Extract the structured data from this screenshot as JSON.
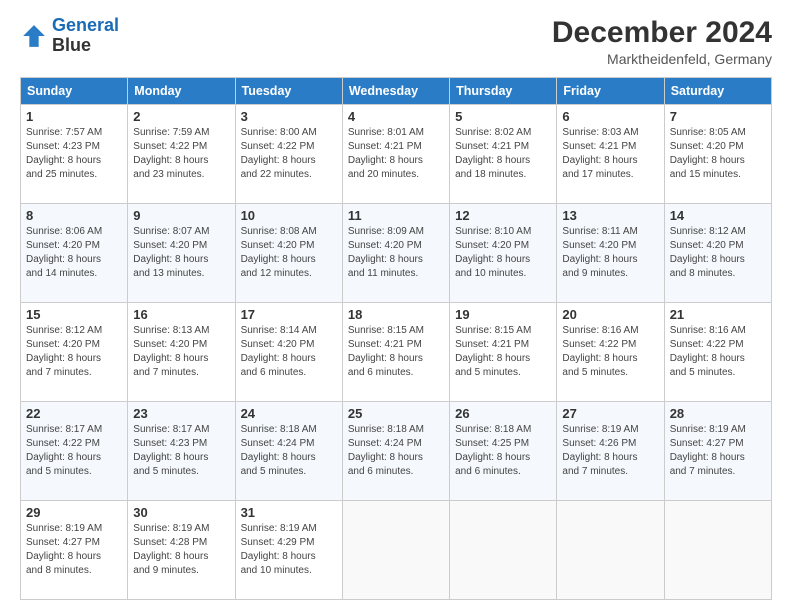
{
  "header": {
    "logo_line1": "General",
    "logo_line2": "Blue",
    "title": "December 2024",
    "subtitle": "Marktheidenfeld, Germany"
  },
  "weekdays": [
    "Sunday",
    "Monday",
    "Tuesday",
    "Wednesday",
    "Thursday",
    "Friday",
    "Saturday"
  ],
  "weeks": [
    [
      {
        "day": "1",
        "info": "Sunrise: 7:57 AM\nSunset: 4:23 PM\nDaylight: 8 hours\nand 25 minutes."
      },
      {
        "day": "2",
        "info": "Sunrise: 7:59 AM\nSunset: 4:22 PM\nDaylight: 8 hours\nand 23 minutes."
      },
      {
        "day": "3",
        "info": "Sunrise: 8:00 AM\nSunset: 4:22 PM\nDaylight: 8 hours\nand 22 minutes."
      },
      {
        "day": "4",
        "info": "Sunrise: 8:01 AM\nSunset: 4:21 PM\nDaylight: 8 hours\nand 20 minutes."
      },
      {
        "day": "5",
        "info": "Sunrise: 8:02 AM\nSunset: 4:21 PM\nDaylight: 8 hours\nand 18 minutes."
      },
      {
        "day": "6",
        "info": "Sunrise: 8:03 AM\nSunset: 4:21 PM\nDaylight: 8 hours\nand 17 minutes."
      },
      {
        "day": "7",
        "info": "Sunrise: 8:05 AM\nSunset: 4:20 PM\nDaylight: 8 hours\nand 15 minutes."
      }
    ],
    [
      {
        "day": "8",
        "info": "Sunrise: 8:06 AM\nSunset: 4:20 PM\nDaylight: 8 hours\nand 14 minutes."
      },
      {
        "day": "9",
        "info": "Sunrise: 8:07 AM\nSunset: 4:20 PM\nDaylight: 8 hours\nand 13 minutes."
      },
      {
        "day": "10",
        "info": "Sunrise: 8:08 AM\nSunset: 4:20 PM\nDaylight: 8 hours\nand 12 minutes."
      },
      {
        "day": "11",
        "info": "Sunrise: 8:09 AM\nSunset: 4:20 PM\nDaylight: 8 hours\nand 11 minutes."
      },
      {
        "day": "12",
        "info": "Sunrise: 8:10 AM\nSunset: 4:20 PM\nDaylight: 8 hours\nand 10 minutes."
      },
      {
        "day": "13",
        "info": "Sunrise: 8:11 AM\nSunset: 4:20 PM\nDaylight: 8 hours\nand 9 minutes."
      },
      {
        "day": "14",
        "info": "Sunrise: 8:12 AM\nSunset: 4:20 PM\nDaylight: 8 hours\nand 8 minutes."
      }
    ],
    [
      {
        "day": "15",
        "info": "Sunrise: 8:12 AM\nSunset: 4:20 PM\nDaylight: 8 hours\nand 7 minutes."
      },
      {
        "day": "16",
        "info": "Sunrise: 8:13 AM\nSunset: 4:20 PM\nDaylight: 8 hours\nand 7 minutes."
      },
      {
        "day": "17",
        "info": "Sunrise: 8:14 AM\nSunset: 4:20 PM\nDaylight: 8 hours\nand 6 minutes."
      },
      {
        "day": "18",
        "info": "Sunrise: 8:15 AM\nSunset: 4:21 PM\nDaylight: 8 hours\nand 6 minutes."
      },
      {
        "day": "19",
        "info": "Sunrise: 8:15 AM\nSunset: 4:21 PM\nDaylight: 8 hours\nand 5 minutes."
      },
      {
        "day": "20",
        "info": "Sunrise: 8:16 AM\nSunset: 4:22 PM\nDaylight: 8 hours\nand 5 minutes."
      },
      {
        "day": "21",
        "info": "Sunrise: 8:16 AM\nSunset: 4:22 PM\nDaylight: 8 hours\nand 5 minutes."
      }
    ],
    [
      {
        "day": "22",
        "info": "Sunrise: 8:17 AM\nSunset: 4:22 PM\nDaylight: 8 hours\nand 5 minutes."
      },
      {
        "day": "23",
        "info": "Sunrise: 8:17 AM\nSunset: 4:23 PM\nDaylight: 8 hours\nand 5 minutes."
      },
      {
        "day": "24",
        "info": "Sunrise: 8:18 AM\nSunset: 4:24 PM\nDaylight: 8 hours\nand 5 minutes."
      },
      {
        "day": "25",
        "info": "Sunrise: 8:18 AM\nSunset: 4:24 PM\nDaylight: 8 hours\nand 6 minutes."
      },
      {
        "day": "26",
        "info": "Sunrise: 8:18 AM\nSunset: 4:25 PM\nDaylight: 8 hours\nand 6 minutes."
      },
      {
        "day": "27",
        "info": "Sunrise: 8:19 AM\nSunset: 4:26 PM\nDaylight: 8 hours\nand 7 minutes."
      },
      {
        "day": "28",
        "info": "Sunrise: 8:19 AM\nSunset: 4:27 PM\nDaylight: 8 hours\nand 7 minutes."
      }
    ],
    [
      {
        "day": "29",
        "info": "Sunrise: 8:19 AM\nSunset: 4:27 PM\nDaylight: 8 hours\nand 8 minutes."
      },
      {
        "day": "30",
        "info": "Sunrise: 8:19 AM\nSunset: 4:28 PM\nDaylight: 8 hours\nand 9 minutes."
      },
      {
        "day": "31",
        "info": "Sunrise: 8:19 AM\nSunset: 4:29 PM\nDaylight: 8 hours\nand 10 minutes."
      },
      null,
      null,
      null,
      null
    ]
  ]
}
